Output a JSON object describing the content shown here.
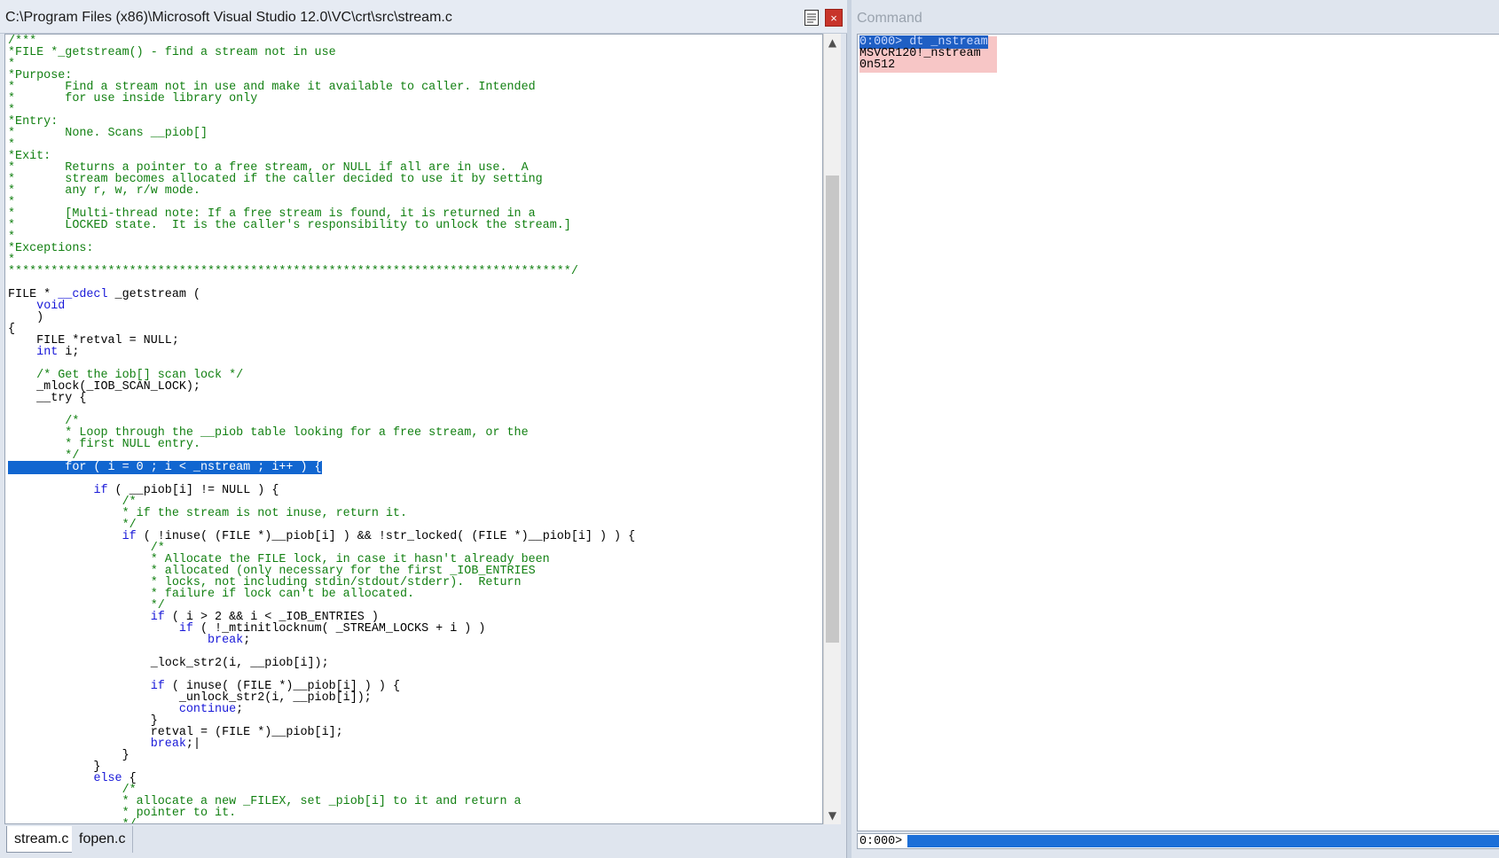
{
  "source_window": {
    "title": "C:\\Program Files (x86)\\Microsoft Visual Studio 12.0\\VC\\crt\\src\\stream.c",
    "close_label": "×",
    "code_lines": [
      [
        {
          "t": "/***",
          "c": "cm"
        }
      ],
      [
        {
          "t": "*FILE *_getstream() - find a stream not in use",
          "c": "cm"
        }
      ],
      [
        {
          "t": "*",
          "c": "cm"
        }
      ],
      [
        {
          "t": "*Purpose:",
          "c": "cm"
        }
      ],
      [
        {
          "t": "*       Find a stream not in use and make it available to caller. Intended",
          "c": "cm"
        }
      ],
      [
        {
          "t": "*       for use inside library only",
          "c": "cm"
        }
      ],
      [
        {
          "t": "*",
          "c": "cm"
        }
      ],
      [
        {
          "t": "*Entry:",
          "c": "cm"
        }
      ],
      [
        {
          "t": "*       None. Scans __piob[]",
          "c": "cm"
        }
      ],
      [
        {
          "t": "*",
          "c": "cm"
        }
      ],
      [
        {
          "t": "*Exit:",
          "c": "cm"
        }
      ],
      [
        {
          "t": "*       Returns a pointer to a free stream, or NULL if all are in use.  A",
          "c": "cm"
        }
      ],
      [
        {
          "t": "*       stream becomes allocated if the caller decided to use it by setting",
          "c": "cm"
        }
      ],
      [
        {
          "t": "*       any r, w, r/w mode.",
          "c": "cm"
        }
      ],
      [
        {
          "t": "*",
          "c": "cm"
        }
      ],
      [
        {
          "t": "*       [Multi-thread note: If a free stream is found, it is returned in a",
          "c": "cm"
        }
      ],
      [
        {
          "t": "*       LOCKED state.  It is the caller's responsibility to unlock the stream.]",
          "c": "cm"
        }
      ],
      [
        {
          "t": "*",
          "c": "cm"
        }
      ],
      [
        {
          "t": "*Exceptions:",
          "c": "cm"
        }
      ],
      [
        {
          "t": "*",
          "c": "cm"
        }
      ],
      [
        {
          "t": "*******************************************************************************/",
          "c": "cm"
        }
      ],
      [],
      [
        {
          "t": "FILE * "
        },
        {
          "t": "__cdecl",
          "c": "kw"
        },
        {
          "t": " _getstream ("
        }
      ],
      [
        {
          "t": "    "
        },
        {
          "t": "void",
          "c": "kw"
        }
      ],
      [
        {
          "t": "    )"
        }
      ],
      [
        {
          "t": "{"
        }
      ],
      [
        {
          "t": "    FILE *retval = NULL;"
        }
      ],
      [
        {
          "t": "    "
        },
        {
          "t": "int",
          "c": "kw"
        },
        {
          "t": " i;"
        }
      ],
      [],
      [
        {
          "t": "    "
        },
        {
          "t": "/* Get the iob[] scan lock */",
          "c": "cm"
        }
      ],
      [
        {
          "t": "    _mlock(_IOB_SCAN_LOCK);"
        }
      ],
      [
        {
          "t": "    __try {"
        }
      ],
      [],
      [
        {
          "t": "        "
        },
        {
          "t": "/*",
          "c": "cm"
        }
      ],
      [
        {
          "t": "        "
        },
        {
          "t": "* Loop through the __piob table looking for a free stream, or the",
          "c": "cm"
        }
      ],
      [
        {
          "t": "        "
        },
        {
          "t": "* first NULL entry.",
          "c": "cm"
        }
      ],
      [
        {
          "t": "        "
        },
        {
          "t": "*/",
          "c": "cm"
        }
      ],
      [
        {
          "t": "        for ( i = 0 ; i < _nstream ; i++ ) {",
          "c": "hl"
        }
      ],
      [],
      [
        {
          "t": "            "
        },
        {
          "t": "if",
          "c": "kw"
        },
        {
          "t": " ( __piob[i] != NULL ) {"
        }
      ],
      [
        {
          "t": "                "
        },
        {
          "t": "/*",
          "c": "cm"
        }
      ],
      [
        {
          "t": "                "
        },
        {
          "t": "* if the stream is not inuse, return it.",
          "c": "cm"
        }
      ],
      [
        {
          "t": "                "
        },
        {
          "t": "*/",
          "c": "cm"
        }
      ],
      [
        {
          "t": "                "
        },
        {
          "t": "if",
          "c": "kw"
        },
        {
          "t": " ( !inuse( (FILE *)__piob[i] ) && !str_locked( (FILE *)__piob[i] ) ) {"
        }
      ],
      [
        {
          "t": "                    "
        },
        {
          "t": "/*",
          "c": "cm"
        }
      ],
      [
        {
          "t": "                    "
        },
        {
          "t": "* Allocate the FILE lock, in case it hasn't already been",
          "c": "cm"
        }
      ],
      [
        {
          "t": "                    "
        },
        {
          "t": "* allocated (only necessary for the first _IOB_ENTRIES",
          "c": "cm"
        }
      ],
      [
        {
          "t": "                    "
        },
        {
          "t": "* locks, not including stdin/stdout/stderr).  Return",
          "c": "cm"
        }
      ],
      [
        {
          "t": "                    "
        },
        {
          "t": "* failure if lock can't be allocated.",
          "c": "cm"
        }
      ],
      [
        {
          "t": "                    "
        },
        {
          "t": "*/",
          "c": "cm"
        }
      ],
      [
        {
          "t": "                    "
        },
        {
          "t": "if",
          "c": "kw"
        },
        {
          "t": " ( i > 2 && i < _IOB_ENTRIES )"
        }
      ],
      [
        {
          "t": "                        "
        },
        {
          "t": "if",
          "c": "kw"
        },
        {
          "t": " ( !_mtinitlocknum( _STREAM_LOCKS + i ) )"
        }
      ],
      [
        {
          "t": "                            "
        },
        {
          "t": "break",
          "c": "kw"
        },
        {
          "t": ";"
        }
      ],
      [],
      [
        {
          "t": "                    _lock_str2(i, __piob[i]);"
        }
      ],
      [],
      [
        {
          "t": "                    "
        },
        {
          "t": "if",
          "c": "kw"
        },
        {
          "t": " ( inuse( (FILE *)__piob[i] ) ) {"
        }
      ],
      [
        {
          "t": "                        _unlock_str2(i, __piob[i]);"
        }
      ],
      [
        {
          "t": "                        "
        },
        {
          "t": "continue",
          "c": "kw"
        },
        {
          "t": ";"
        }
      ],
      [
        {
          "t": "                    }"
        }
      ],
      [
        {
          "t": "                    retval = (FILE *)__piob[i];"
        }
      ],
      [
        {
          "t": "                    "
        },
        {
          "t": "break",
          "c": "kw"
        },
        {
          "t": ";|"
        }
      ],
      [
        {
          "t": "                }"
        }
      ],
      [
        {
          "t": "            }"
        }
      ],
      [
        {
          "t": "            "
        },
        {
          "t": "else",
          "c": "kw"
        },
        {
          "t": " {"
        }
      ],
      [
        {
          "t": "                "
        },
        {
          "t": "/*",
          "c": "cm"
        }
      ],
      [
        {
          "t": "                "
        },
        {
          "t": "* allocate a new _FILEX, set _piob[i] to it and return a",
          "c": "cm"
        }
      ],
      [
        {
          "t": "                "
        },
        {
          "t": "* pointer to it.",
          "c": "cm"
        }
      ],
      [
        {
          "t": "                "
        },
        {
          "t": "*/",
          "c": "cm"
        }
      ]
    ],
    "tabs": [
      {
        "label": "stream.c",
        "active": true
      },
      {
        "label": "fopen.c",
        "active": false
      }
    ]
  },
  "command_window": {
    "title": "Command",
    "output_lines": [
      {
        "text": "0:000> dt _nstream",
        "selected": true
      },
      {
        "text": "MSVCR120!_nstream",
        "selected": false
      },
      {
        "text": "0n512",
        "selected": false
      }
    ],
    "prompt": "0:000>",
    "input_value": ""
  },
  "colors": {
    "comment": "#128012",
    "keyword": "#1818d8",
    "highlight": "#1166d0",
    "command_output_bg": "#f7c6c6"
  },
  "icons": [
    "document-icon",
    "close-icon",
    "scroll-up-arrow-icon",
    "scroll-down-arrow-icon"
  ]
}
